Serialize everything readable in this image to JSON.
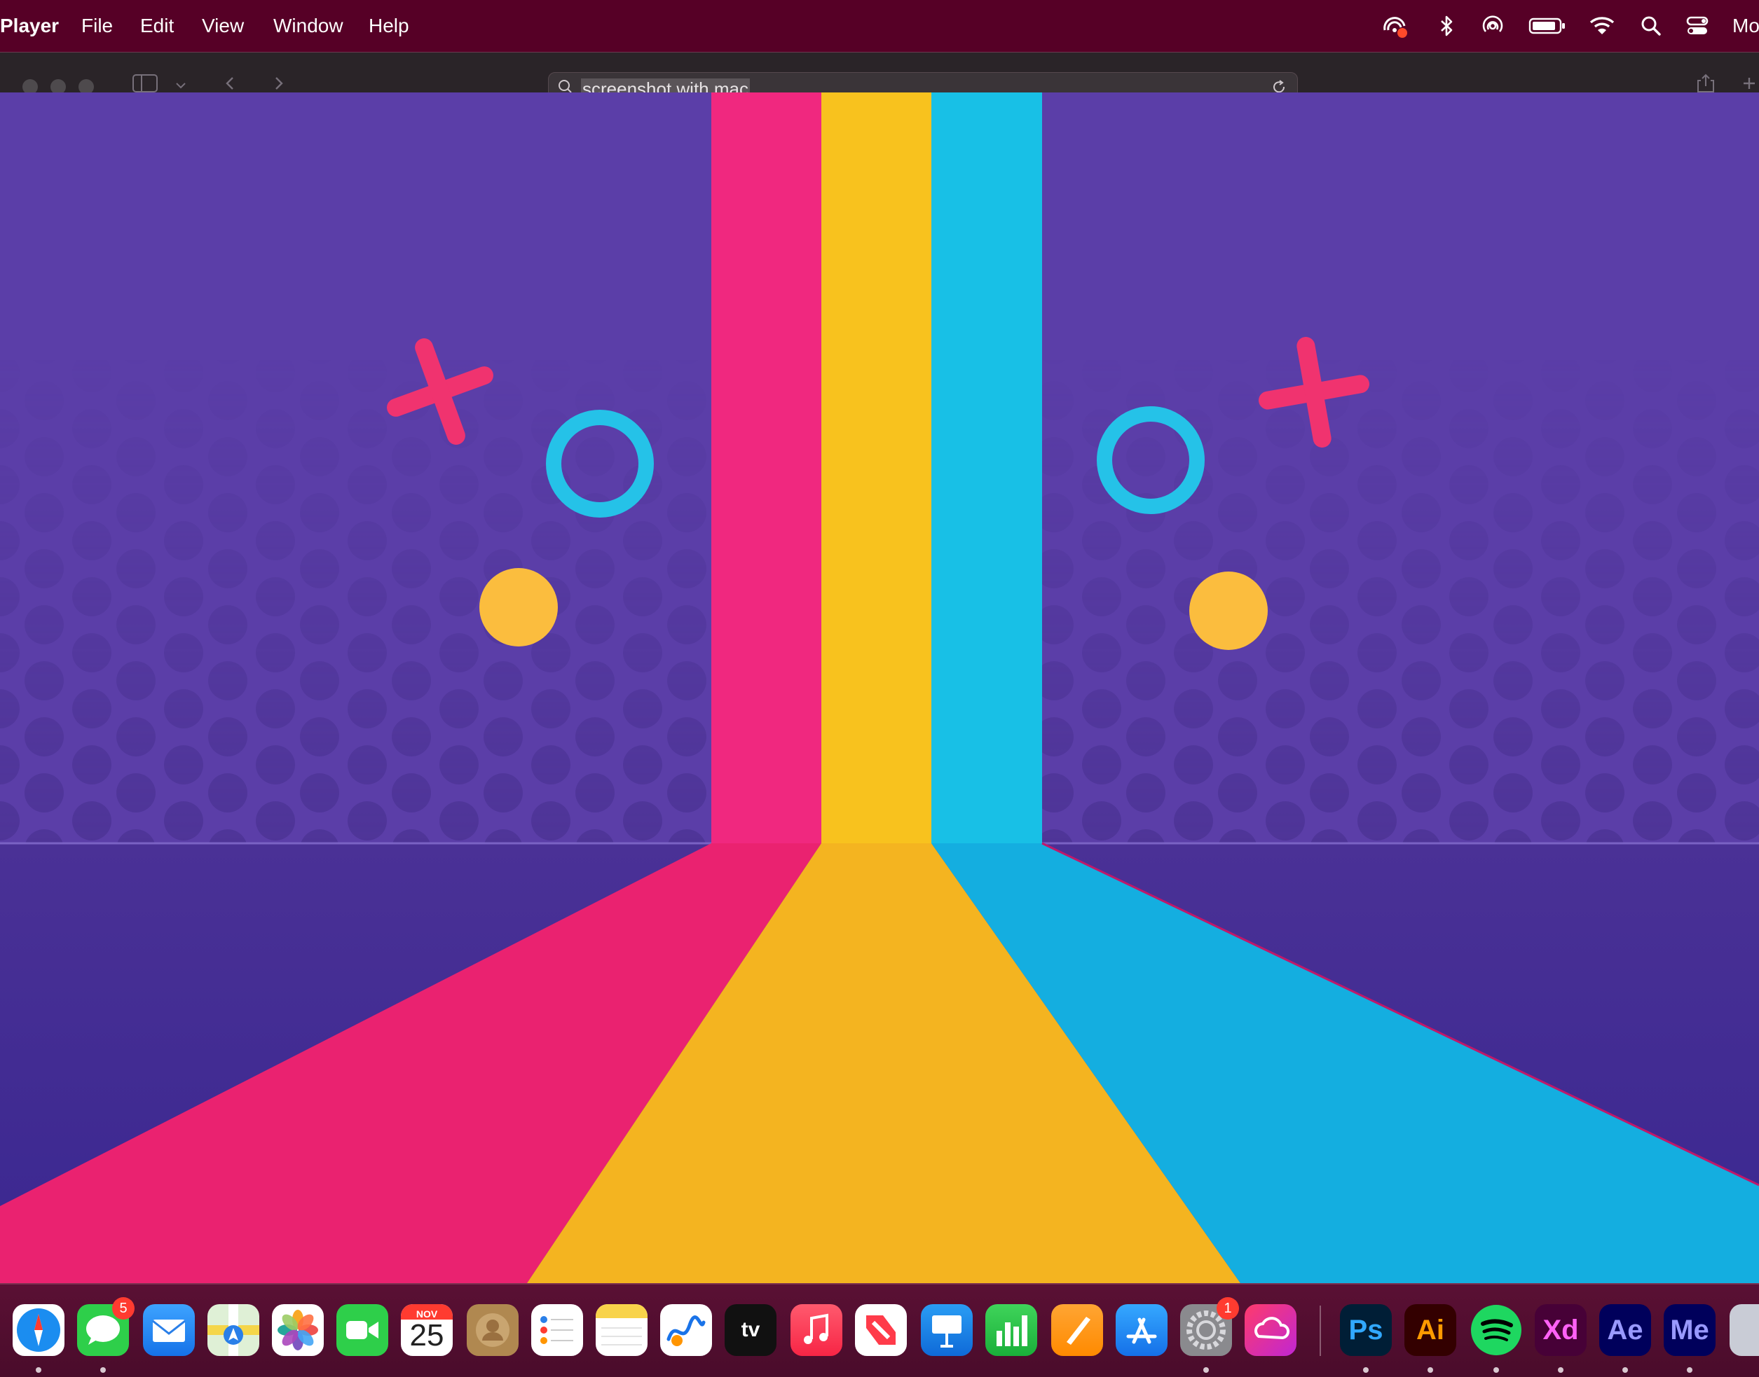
{
  "menubar": {
    "app_name": "Player",
    "items": [
      {
        "label": "File"
      },
      {
        "label": "Edit"
      },
      {
        "label": "View"
      },
      {
        "label": "Window"
      },
      {
        "label": "Help"
      }
    ],
    "status_icons": [
      "screen-recording-icon",
      "bluetooth-icon",
      "airdrop-icon",
      "battery-icon",
      "wifi-icon",
      "spotlight-search-icon",
      "control-center-icon"
    ],
    "clock_text": "Mo"
  },
  "toolbar": {
    "url": "screenshot with mac",
    "icons": [
      "sidebar-toggle-icon",
      "chevron-down-icon",
      "back-icon",
      "forward-icon",
      "search-icon",
      "reload-icon",
      "share-icon",
      "new-tab-icon"
    ]
  },
  "wallpaper": {
    "colors": {
      "purple": "#5a3da5",
      "pink": "#f0287f",
      "yellow": "#f8c21e",
      "cyan": "#13b8e0"
    }
  },
  "dock": {
    "apps": [
      {
        "name": "Safari",
        "icon": "safari-icon",
        "running": true
      },
      {
        "name": "Messages",
        "icon": "messages-icon",
        "badge": "5",
        "running": true
      },
      {
        "name": "Mail",
        "icon": "mail-icon"
      },
      {
        "name": "Maps",
        "icon": "maps-icon"
      },
      {
        "name": "Photos",
        "icon": "photos-icon"
      },
      {
        "name": "FaceTime",
        "icon": "facetime-icon"
      },
      {
        "name": "Calendar",
        "icon": "calendar-icon",
        "month": "NOV",
        "day": "25"
      },
      {
        "name": "Contacts",
        "icon": "contacts-icon"
      },
      {
        "name": "Reminders",
        "icon": "reminders-icon"
      },
      {
        "name": "Notes",
        "icon": "notes-icon"
      },
      {
        "name": "Freeform",
        "icon": "freeform-icon"
      },
      {
        "name": "TV",
        "icon": "apple-tv-icon",
        "label": "tv"
      },
      {
        "name": "Music",
        "icon": "music-icon"
      },
      {
        "name": "News",
        "icon": "news-icon"
      },
      {
        "name": "Keynote",
        "icon": "keynote-icon"
      },
      {
        "name": "Numbers",
        "icon": "numbers-icon"
      },
      {
        "name": "Pages",
        "icon": "pages-icon"
      },
      {
        "name": "App Store",
        "icon": "app-store-icon"
      },
      {
        "name": "System Settings",
        "icon": "system-settings-icon",
        "badge": "1",
        "running": true
      },
      {
        "name": "Creative Cloud",
        "icon": "creative-cloud-icon"
      },
      {
        "name": "Photoshop",
        "icon": "photoshop-icon",
        "label": "Ps",
        "running": true
      },
      {
        "name": "Illustrator",
        "icon": "illustrator-icon",
        "label": "Ai",
        "running": true
      },
      {
        "name": "Spotify",
        "icon": "spotify-icon",
        "running": true
      },
      {
        "name": "Adobe XD",
        "icon": "adobe-xd-icon",
        "label": "Xd",
        "running": true
      },
      {
        "name": "After Effects",
        "icon": "after-effects-icon",
        "label": "Ae",
        "running": true
      },
      {
        "name": "Media Encoder",
        "icon": "media-encoder-icon",
        "label": "Me",
        "running": true
      }
    ]
  }
}
